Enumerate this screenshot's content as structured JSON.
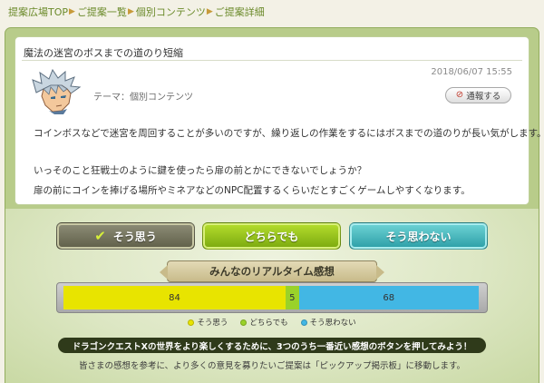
{
  "breadcrumb": {
    "items": [
      "提案広場TOP",
      "ご提案一覧",
      "個別コンテンツ",
      "ご提案詳細"
    ]
  },
  "proposal": {
    "title": "魔法の迷宮のボスまでの道のり短縮",
    "timestamp": "2018/06/07 15:55",
    "theme": "テーマ：個別コンテンツ",
    "report_label": "通報する",
    "body": [
      "コインボスなどで迷宮を周回することが多いのですが、繰り返しの作業をするにはボスまでの道のりが長い気がします。",
      "いっそのこと狂戦士のように鍵を使ったら扉の前とかにできないでしょうか？",
      "扉の前にコインを捧げる場所やミネアなどのNPC配置するくらいだとすごくゲームしやすくなります。"
    ]
  },
  "votes": {
    "agree_label": "そう思う",
    "neutral_label": "どちらでも",
    "disagree_label": "そう思わない"
  },
  "realtime": {
    "header": "みんなのリアルタイム感想",
    "agree": 84,
    "neutral": 5,
    "disagree": 68,
    "agree_value": "84",
    "neutral_value": "5",
    "disagree_value": "68",
    "legend": [
      "そう思う",
      "どちらでも",
      "そう思わない"
    ],
    "colors": {
      "agree": "#e8e400",
      "neutral": "#9ad229",
      "disagree": "#42b7e4"
    }
  },
  "notice": {
    "banner": "ドラゴンクエストXの世界をより楽しくするために、3つのうち一番近い感想のボタンを押してみよう！",
    "note": "皆さまの感想を参考に、より多くの意見を募りたいご提案は「ピックアップ掲示板」に移動します。"
  },
  "icons": {
    "check": "check-icon",
    "report": "no-entry-icon",
    "crumb_separator": "chevron-right-icon"
  }
}
